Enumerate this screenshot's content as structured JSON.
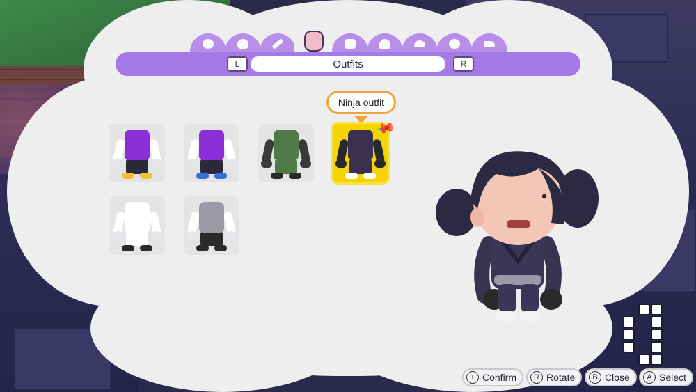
{
  "header": {
    "title": "Outfits",
    "left_button": "L",
    "right_button": "R"
  },
  "tabs": [
    {
      "icon": "face-icon"
    },
    {
      "icon": "hair-icon"
    },
    {
      "icon": "makeup-icon"
    },
    {
      "icon": "outfit-icon",
      "selected": true
    },
    {
      "icon": "shirt-icon"
    },
    {
      "icon": "house-icon"
    },
    {
      "icon": "hat-icon"
    },
    {
      "icon": "accessory-icon"
    },
    {
      "icon": "shoe-icon"
    }
  ],
  "tooltip": "Ninja outfit",
  "outfits": [
    {
      "name": "purple-zip-jacket",
      "body": "#8b2fd6",
      "legs": "#2a2a3a",
      "shoe": "#f1c232",
      "arm": "#fff"
    },
    {
      "name": "purple-hoodie",
      "body": "#8b2fd6",
      "legs": "#2a2a3a",
      "shoe": "#3a6fd8",
      "arm": "#fff"
    },
    {
      "name": "green-coverall",
      "body": "#4f7a46",
      "legs": "#4f7a46",
      "shoe": "#2a2a2a",
      "arm": "#3a3a3a"
    },
    {
      "name": "ninja-outfit",
      "body": "#3a3050",
      "legs": "#3a3050",
      "shoe": "#fff",
      "arm": "#2a2a2a",
      "selected": true
    },
    {
      "name": "sailor-outfit",
      "body": "#ffffff",
      "legs": "#ffffff",
      "shoe": "#2a2a2a",
      "arm": "#fff"
    },
    {
      "name": "plaid-shirt",
      "body": "#9a9aa6",
      "legs": "#2a2a2a",
      "shoe": "#2a2a2a",
      "arm": "#fff"
    }
  ],
  "controls": [
    {
      "glyph": "+",
      "label": "Confirm"
    },
    {
      "glyph": "R",
      "label": "Rotate"
    },
    {
      "glyph": "B",
      "label": "Close"
    },
    {
      "glyph": "A",
      "label": "Select"
    }
  ],
  "colors": {
    "accent": "#a47be6",
    "tab": "#b78fe8",
    "selection": "#f5d400",
    "tooltip_border": "#f0a23a",
    "panel": "#efeeef"
  }
}
